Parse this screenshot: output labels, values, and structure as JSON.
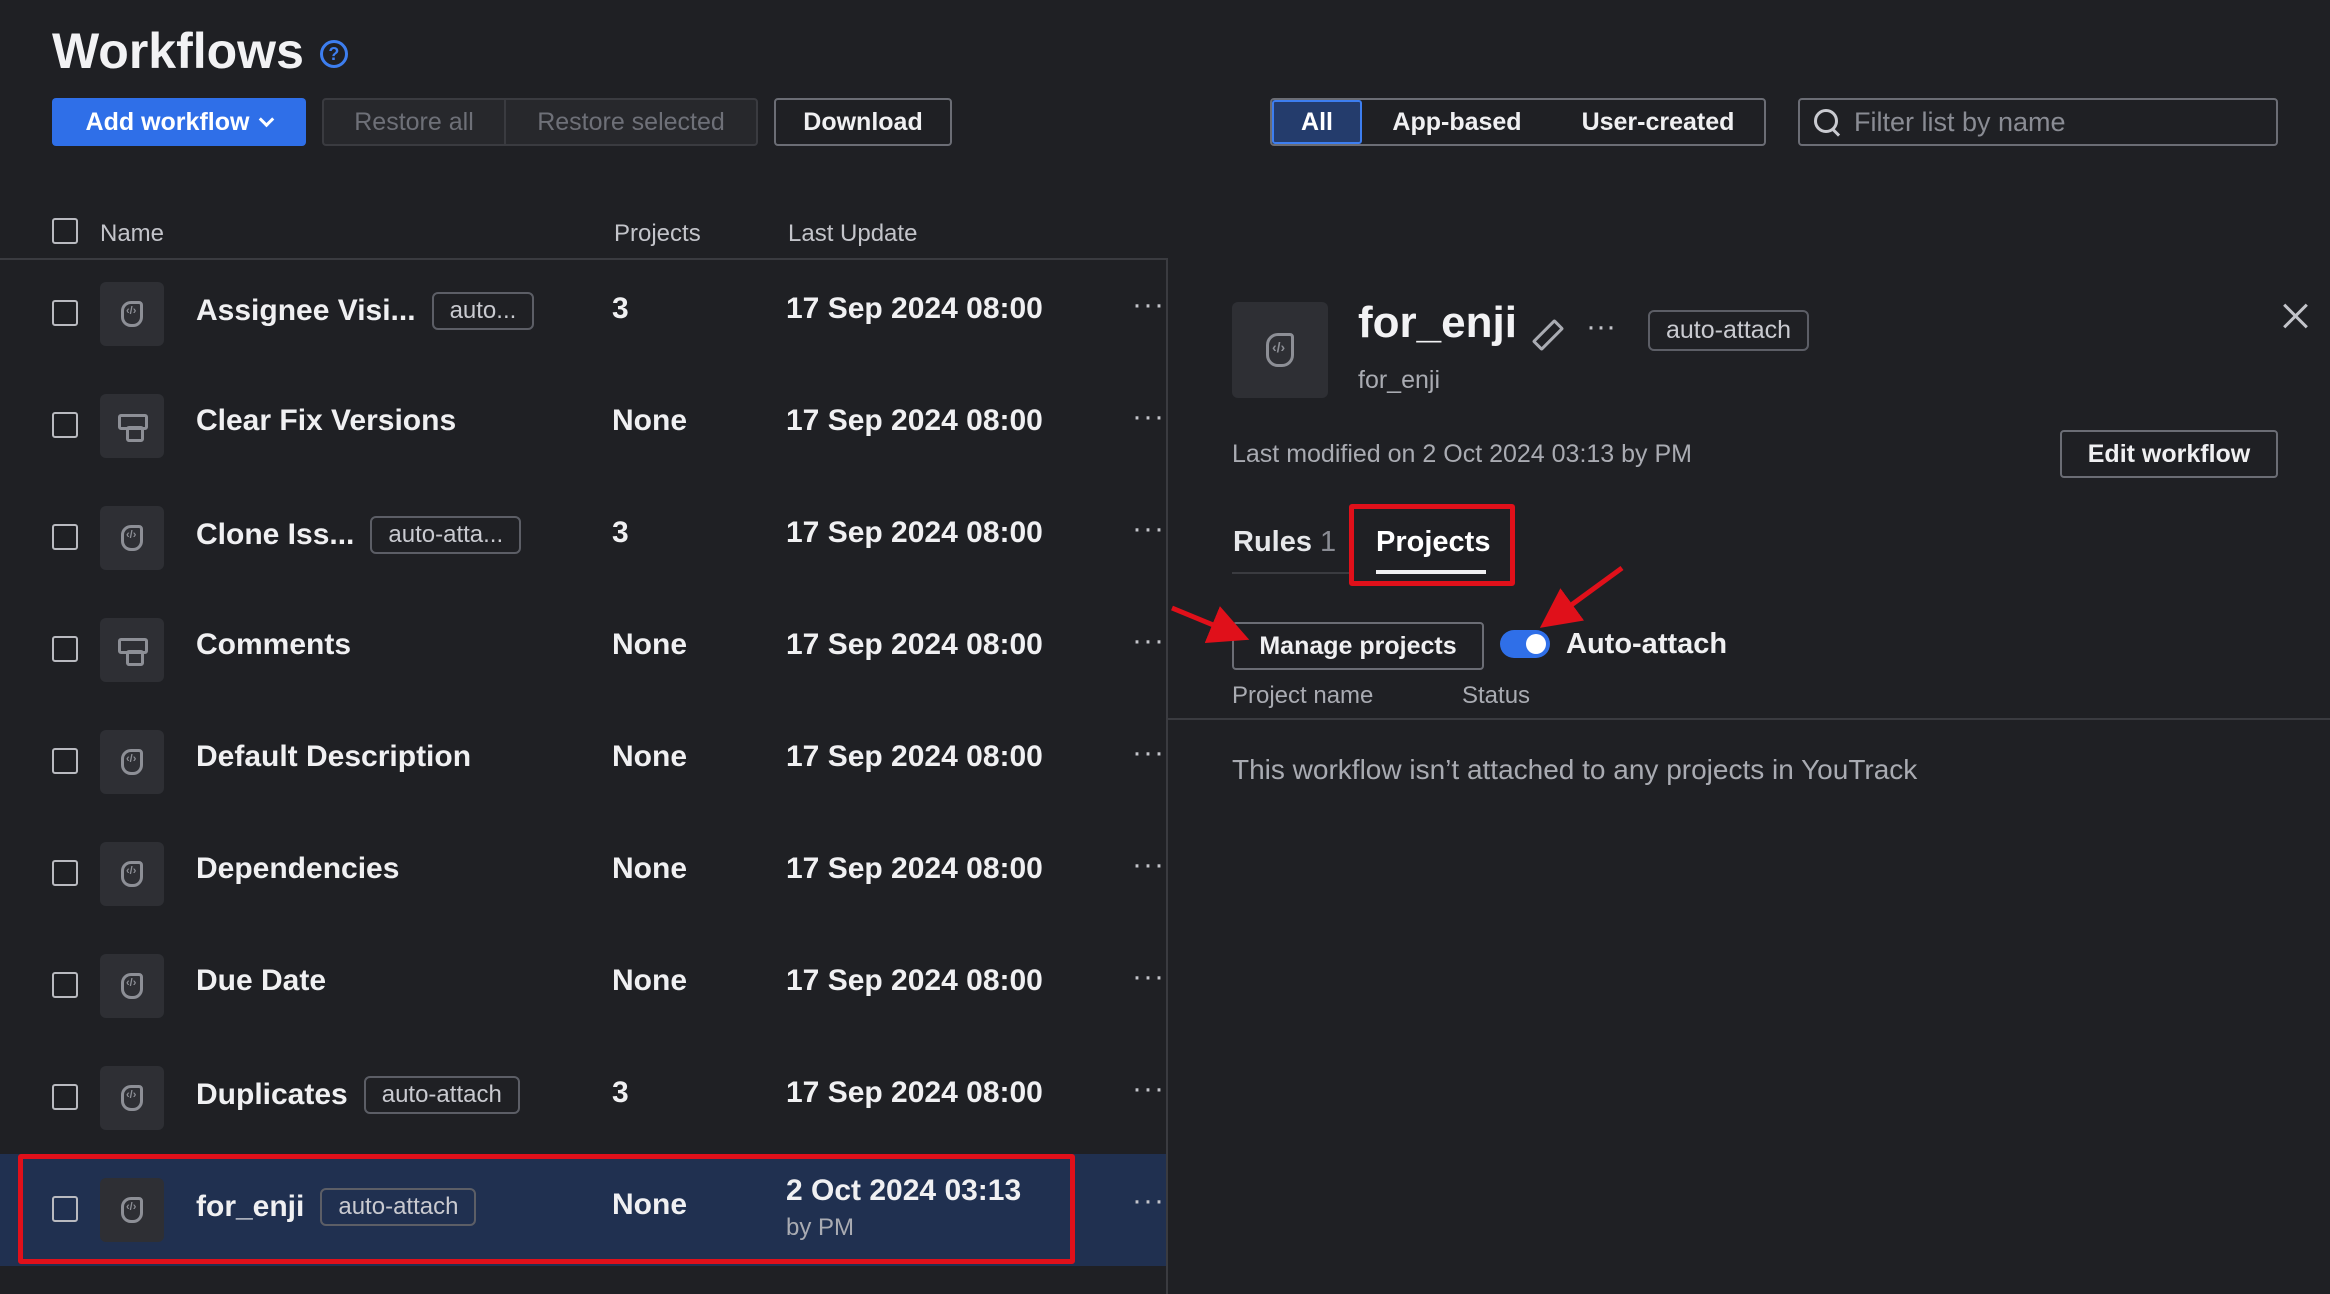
{
  "header": {
    "title": "Workflows",
    "help_icon": "?",
    "add_workflow": "Add workflow",
    "restore_all": "Restore all",
    "restore_selected": "Restore selected",
    "download": "Download",
    "filters": [
      "All",
      "App-based",
      "User-created"
    ],
    "selected_filter": "All",
    "search_placeholder": "Filter list by name"
  },
  "table": {
    "columns": [
      "Name",
      "Projects",
      "Last Update"
    ],
    "rows": [
      {
        "name": "Assignee Visi...",
        "tag": "auto...",
        "projects": "3",
        "updated": "17 Sep 2024 08:00",
        "icon": "workflow-script-icon"
      },
      {
        "name": "Clear Fix Versions",
        "tag": "",
        "projects": "None",
        "updated": "17 Sep 2024 08:00",
        "icon": "workflow-rule-icon"
      },
      {
        "name": "Clone Iss...",
        "tag": "auto-atta...",
        "projects": "3",
        "updated": "17 Sep 2024 08:00",
        "icon": "workflow-script-icon"
      },
      {
        "name": "Comments",
        "tag": "",
        "projects": "None",
        "updated": "17 Sep 2024 08:00",
        "icon": "workflow-rule-icon"
      },
      {
        "name": "Default Description",
        "tag": "",
        "projects": "None",
        "updated": "17 Sep 2024 08:00",
        "icon": "workflow-script-icon"
      },
      {
        "name": "Dependencies",
        "tag": "",
        "projects": "None",
        "updated": "17 Sep 2024 08:00",
        "icon": "workflow-script-icon"
      },
      {
        "name": "Due Date",
        "tag": "",
        "projects": "None",
        "updated": "17 Sep 2024 08:00",
        "icon": "workflow-script-icon"
      },
      {
        "name": "Duplicates",
        "tag": "auto-attach",
        "projects": "3",
        "updated": "17 Sep 2024 08:00",
        "icon": "workflow-script-icon"
      },
      {
        "name": "for_enji",
        "tag": "auto-attach",
        "projects": "None",
        "updated": "2 Oct 2024 03:13",
        "by": "by PM",
        "icon": "workflow-script-icon",
        "selected": true
      }
    ]
  },
  "detail": {
    "title": "for_enji",
    "subtitle": "for_enji",
    "tag": "auto-attach",
    "last_modified": "Last modified on 2 Oct 2024 03:13 by PM",
    "edit_button": "Edit workflow",
    "tab_rules": "Rules",
    "tab_rules_count": "1",
    "tab_projects": "Projects",
    "manage_projects": "Manage projects",
    "auto_attach_label": "Auto-attach",
    "auto_attach_on": true,
    "col_project_name": "Project name",
    "col_status": "Status",
    "empty_message": "This workflow isn’t attached to any projects in YouTrack"
  },
  "colors": {
    "accent": "#2f6fe8",
    "annotation": "#e0101a",
    "background": "#1f2024",
    "selected_row": "#203050"
  }
}
